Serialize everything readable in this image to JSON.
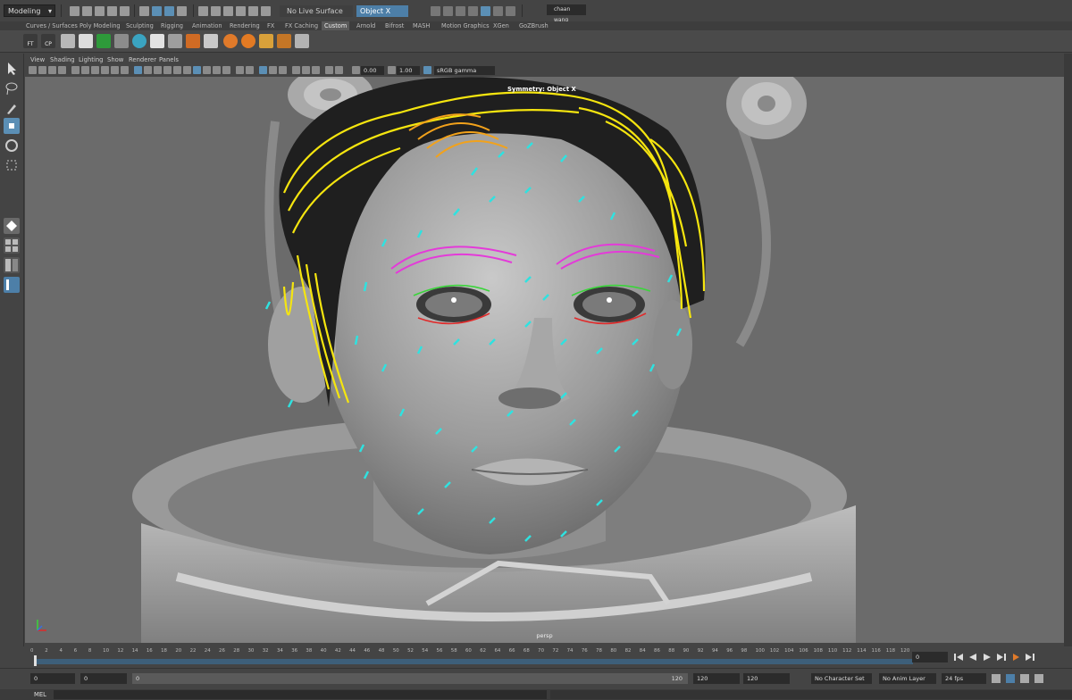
{
  "status_line": {
    "mode": "Modeling",
    "live_surface": "No Live Surface",
    "symmetry": "Object X",
    "user": "chaan wang"
  },
  "shelf": {
    "tabs": [
      "Curves / Surfaces",
      "Poly Modeling",
      "Sculpting",
      "Rigging",
      "Animation",
      "Rendering",
      "FX",
      "FX Caching",
      "Custom",
      "Arnold",
      "Bifrost",
      "MASH",
      "Motion Graphics",
      "XGen",
      "GoZBrush"
    ],
    "active_tab": "Custom",
    "icon_labels": {
      "ft": "FT",
      "cp": "CP"
    }
  },
  "panel_menu": [
    "View",
    "Shading",
    "Lighting",
    "Show",
    "Renderer",
    "Panels"
  ],
  "panel_toolbar": {
    "exposure": "0.00",
    "gamma": "1.00",
    "color_space": "sRGB gamma"
  },
  "viewport": {
    "symmetry_label": "Symmetry: Object X",
    "camera": "persp"
  },
  "timeline": {
    "ticks": [
      "0",
      "2",
      "4",
      "6",
      "8",
      "10",
      "12",
      "14",
      "16",
      "18",
      "20",
      "22",
      "24",
      "26",
      "28",
      "30",
      "32",
      "34",
      "36",
      "38",
      "40",
      "42",
      "44",
      "46",
      "48",
      "50",
      "52",
      "54",
      "56",
      "58",
      "60",
      "62",
      "64",
      "66",
      "68",
      "70",
      "72",
      "74",
      "76",
      "78",
      "80",
      "82",
      "84",
      "86",
      "88",
      "90",
      "92",
      "94",
      "96",
      "98",
      "100",
      "102",
      "104",
      "106",
      "108",
      "110",
      "112",
      "114",
      "116",
      "118",
      "120"
    ],
    "current_frame": "0"
  },
  "range": {
    "start": "0",
    "playback_start": "0",
    "range_start_label": "0",
    "range_end_label": "120",
    "playback_end": "120",
    "end": "120",
    "character_set": "No Character Set",
    "anim_layer": "No Anim Layer",
    "fps": "24 fps"
  },
  "command_line": {
    "language": "MEL"
  },
  "colors": {
    "ui_bg": "#444444",
    "viewport_bg": "#6a6a6a",
    "accent": "#5b8fb5",
    "guide_yellow": "#f5e50f",
    "guide_orange": "#f2a21b",
    "guide_magenta": "#e43ad9",
    "guide_cyan": "#2fe2e0",
    "guide_green": "#3bd43b",
    "guide_red": "#e02a2a"
  }
}
